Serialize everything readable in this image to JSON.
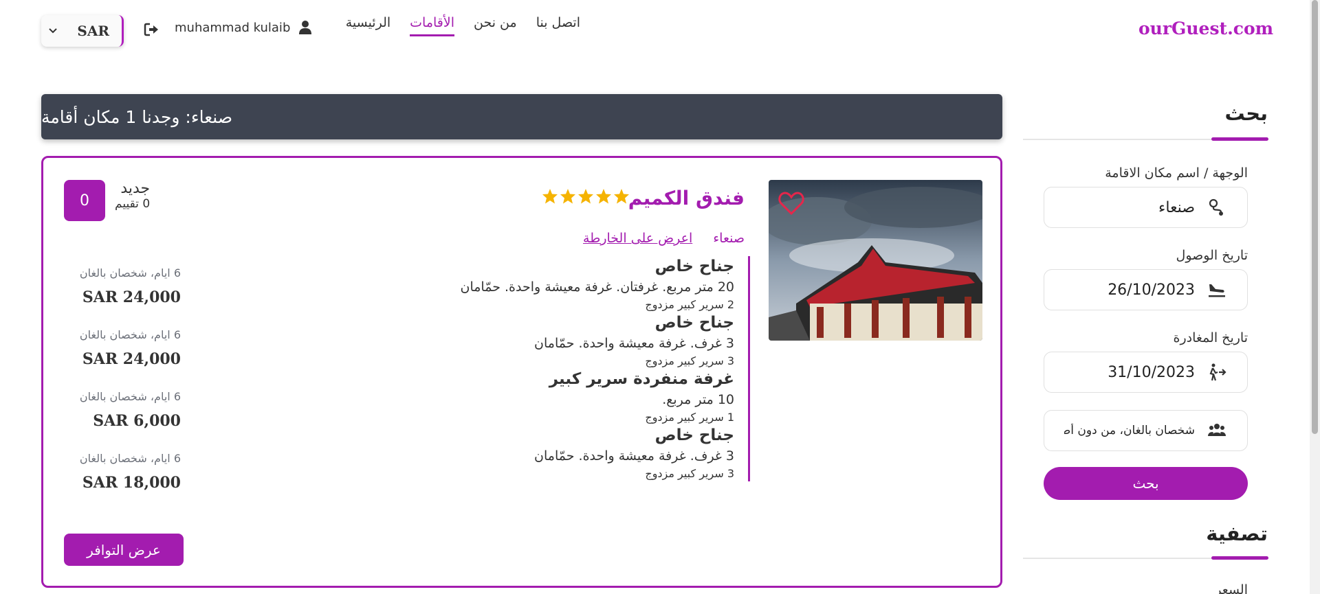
{
  "brand": "ourGuest.com",
  "nav": {
    "items": [
      {
        "label": "الرئيسية",
        "active": false
      },
      {
        "label": "الأقامات",
        "active": true
      },
      {
        "label": "من نحن",
        "active": false
      },
      {
        "label": "اتصل بنا",
        "active": false
      }
    ]
  },
  "user": {
    "name": "muhammad kulaib",
    "icon": "user-icon"
  },
  "currency": {
    "value": "SAR"
  },
  "results": {
    "summary": "صنعاء: وجدنا 1 مكان أقامة"
  },
  "hotel": {
    "name": "فندق الكميم",
    "stars": 5,
    "city": "صنعاء",
    "map_link": "اعرض على الخارطة",
    "rating": {
      "score": "0",
      "label": "جديد",
      "reviews": "0 تقييم"
    },
    "rooms": [
      {
        "name": "جناح خاص",
        "desc": "20 متر مربع. غرفتان. غرفة معيشة واحدة. حمّامان",
        "bed": "2 سرير كبير مزدوج"
      },
      {
        "name": "جناح خاص",
        "desc": "3 غرف. غرفة معيشة واحدة. حمّامان",
        "bed": "3 سرير كبير مزدوج"
      },
      {
        "name": "غرفة منفردة سرير كبير",
        "desc": "10 متر مربع.",
        "bed": "1 سرير كبير مزدوج"
      },
      {
        "name": "جناح خاص",
        "desc": "3 غرف. غرفة معيشة واحدة. حمّامان",
        "bed": "3 سرير كبير مزدوج"
      }
    ],
    "prices": [
      {
        "meta": "6 ايام، شخصان بالغان",
        "price": "SAR 24,000"
      },
      {
        "meta": "6 ايام، شخصان بالغان",
        "price": "SAR 24,000"
      },
      {
        "meta": "6 ايام، شخصان بالغان",
        "price": "SAR 6,000"
      },
      {
        "meta": "6 ايام، شخصان بالغان",
        "price": "SAR 18,000"
      }
    ],
    "availability_button": "عرض التوافر"
  },
  "sidebar": {
    "search_title": "بحث",
    "destination_label": "الوجهة / اسم مكان الاقامة",
    "destination_value": "صنعاء",
    "checkin_label": "تاريخ الوصول",
    "checkin_value": "26/10/2023",
    "checkout_label": "تاريخ المغادرة",
    "checkout_value": "31/10/2023",
    "guests_value": "شخصان بالغان، من دون أطفال",
    "search_button": "بحث",
    "filter_title": "تصفية",
    "price_label": "السعر"
  }
}
